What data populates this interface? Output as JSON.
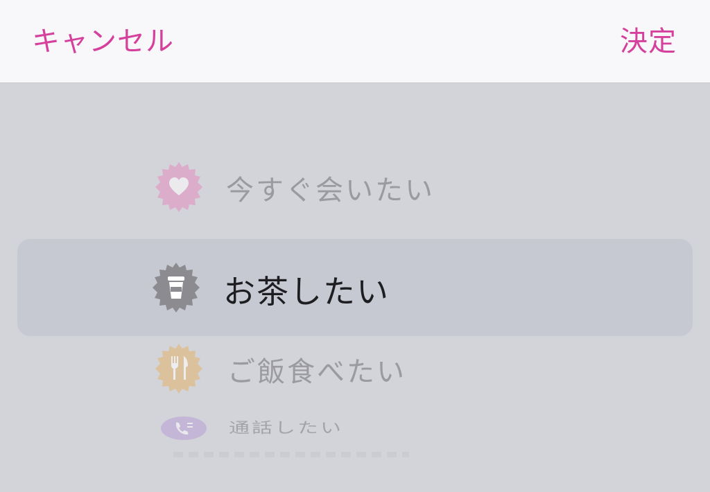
{
  "toolbar": {
    "cancel_label": "キャンセル",
    "confirm_label": "決定",
    "accent_color": "#d5409d"
  },
  "picker": {
    "items": [
      {
        "label": "今すぐ会いたい",
        "icon": "heart-icon",
        "color": "#e38fc0"
      },
      {
        "label": "お茶したい",
        "icon": "coffee-cup-icon",
        "color": "#8c8c90",
        "selected": true
      },
      {
        "label": "ご飯食べたい",
        "icon": "fork-knife-icon",
        "color": "#e3b774"
      },
      {
        "label": "通話したい",
        "icon": "phone-icon",
        "color": "#b59ad6"
      }
    ]
  }
}
